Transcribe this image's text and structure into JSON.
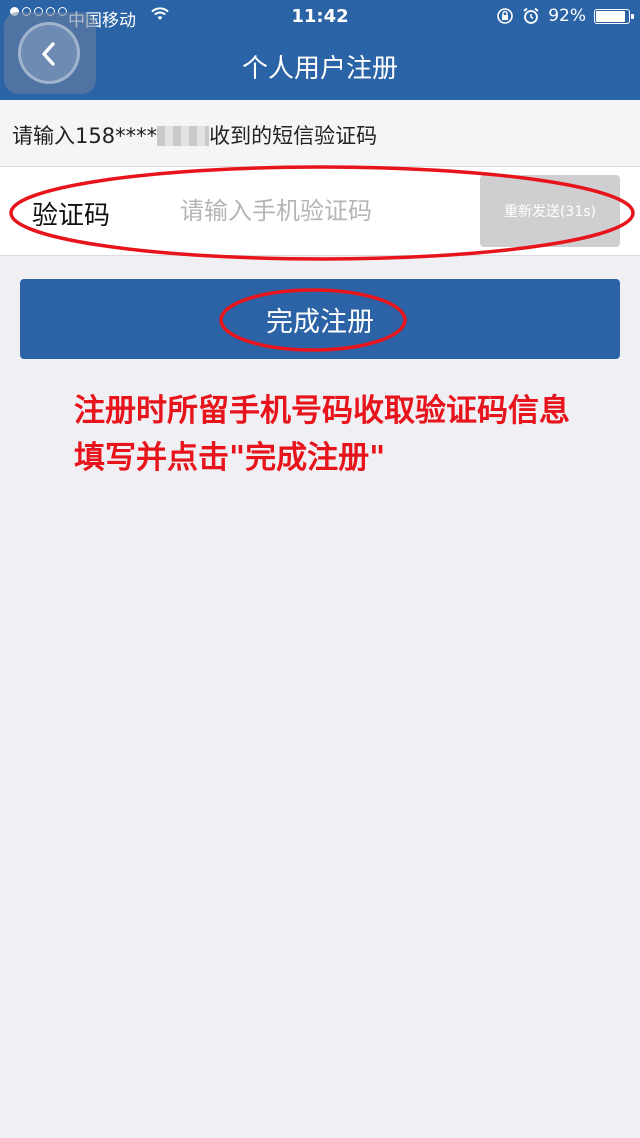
{
  "status_bar": {
    "carrier": "中国移动",
    "time": "11:42",
    "battery_percent": "92%",
    "battery_level": 0.92,
    "signal_bars_filled": 1,
    "signal_bars_total": 5
  },
  "nav": {
    "title": "个人用户注册",
    "back_icon": "chevron-left-icon"
  },
  "hint": {
    "prefix": "请输入158****",
    "suffix": "收到的短信验证码"
  },
  "code_field": {
    "label": "验证码",
    "placeholder": "请输入手机验证码",
    "value": ""
  },
  "resend_button": {
    "label": "重新发送(31s)"
  },
  "submit_button": {
    "label": "完成注册"
  },
  "annotation": {
    "line1": "注册时所留手机号码收取验证码信息",
    "line2": "填写并点击\"完成注册\""
  },
  "colors": {
    "header": "#2a63a6",
    "button": "#2b63a6",
    "annotation_red": "#e8141b",
    "background": "#efeff4"
  }
}
